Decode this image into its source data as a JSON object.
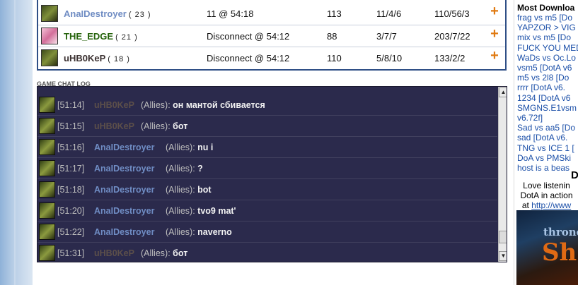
{
  "players": [
    {
      "name": "AnaIDestroyer",
      "level": "( 23 )",
      "left": "11 @ 54:18",
      "creeps": "113",
      "kda": "11/4/6",
      "cs": "110/56/3",
      "color": "blue"
    },
    {
      "name": "THE_EDGE",
      "level": "( 21 )",
      "left": "Disconnect @ 54:12",
      "creeps": "88",
      "kda": "3/7/7",
      "cs": "203/7/22",
      "color": "green"
    },
    {
      "name": "uHB0KeP",
      "level": "( 18 )",
      "left": "Disconnect @ 54:12",
      "creeps": "110",
      "kda": "5/8/10",
      "cs": "133/2/2",
      "color": "dark"
    }
  ],
  "chat": {
    "title": "GAME CHAT LOG",
    "lines": [
      {
        "time": "[51:14]",
        "who": "uHB0KeP",
        "channel": "(Allies):",
        "msg": "он мантой сбивается",
        "color": "dark"
      },
      {
        "time": "[51:15]",
        "who": "uHB0KeP",
        "channel": "(Allies):",
        "msg": "бот",
        "color": "dark"
      },
      {
        "time": "[51:16]",
        "who": "AnaIDestroyer",
        "channel": "(Allies):",
        "msg": "nu i",
        "color": "blue"
      },
      {
        "time": "[51:17]",
        "who": "AnaIDestroyer",
        "channel": "(Allies):",
        "msg": "?",
        "color": "blue"
      },
      {
        "time": "[51:18]",
        "who": "AnaIDestroyer",
        "channel": "(Allies):",
        "msg": "bot",
        "color": "blue"
      },
      {
        "time": "[51:20]",
        "who": "AnaIDestroyer",
        "channel": "(Allies):",
        "msg": "tvo9 mat'",
        "color": "blue"
      },
      {
        "time": "[51:22]",
        "who": "AnaIDestroyer",
        "channel": "(Allies):",
        "msg": "naverno",
        "color": "blue"
      },
      {
        "time": "[51:31]",
        "who": "uHB0KeP",
        "channel": "(Allies):",
        "msg": "бот",
        "color": "dark"
      }
    ]
  },
  "sidebar": {
    "title": "Most Downloa",
    "downloads": [
      "frag vs m5 [Do",
      "YAPZOR > VIG",
      "mix vs m5 [Do",
      "FUCK YOU MED",
      "WaDs vs Oc.Lo",
      "vsm5 [DotA v6",
      "m5 vs 2l8 [Do",
      "rrrr [DotA v6.",
      "1234 [DotA v6",
      "SMGNS.E1vsm",
      "v6.72f]",
      "Sad vs aa5 [Do",
      "sad [DotA v6.",
      "TNG vs ICE 1 [",
      "DoA vs PMSki",
      "host is a beas"
    ],
    "heading": "D",
    "text_lines": [
      "Love listenin",
      "DotA in action"
    ],
    "text_at": "at",
    "text_link": "http://www",
    "banner_top": "throne",
    "banner_main": "Sh"
  },
  "colors": {
    "chat_bg": "#2b2a4c",
    "name_blue": "#6f8cc3",
    "name_green": "#24620a",
    "accent_plus": "#e07a12",
    "link": "#1b4fa8"
  }
}
